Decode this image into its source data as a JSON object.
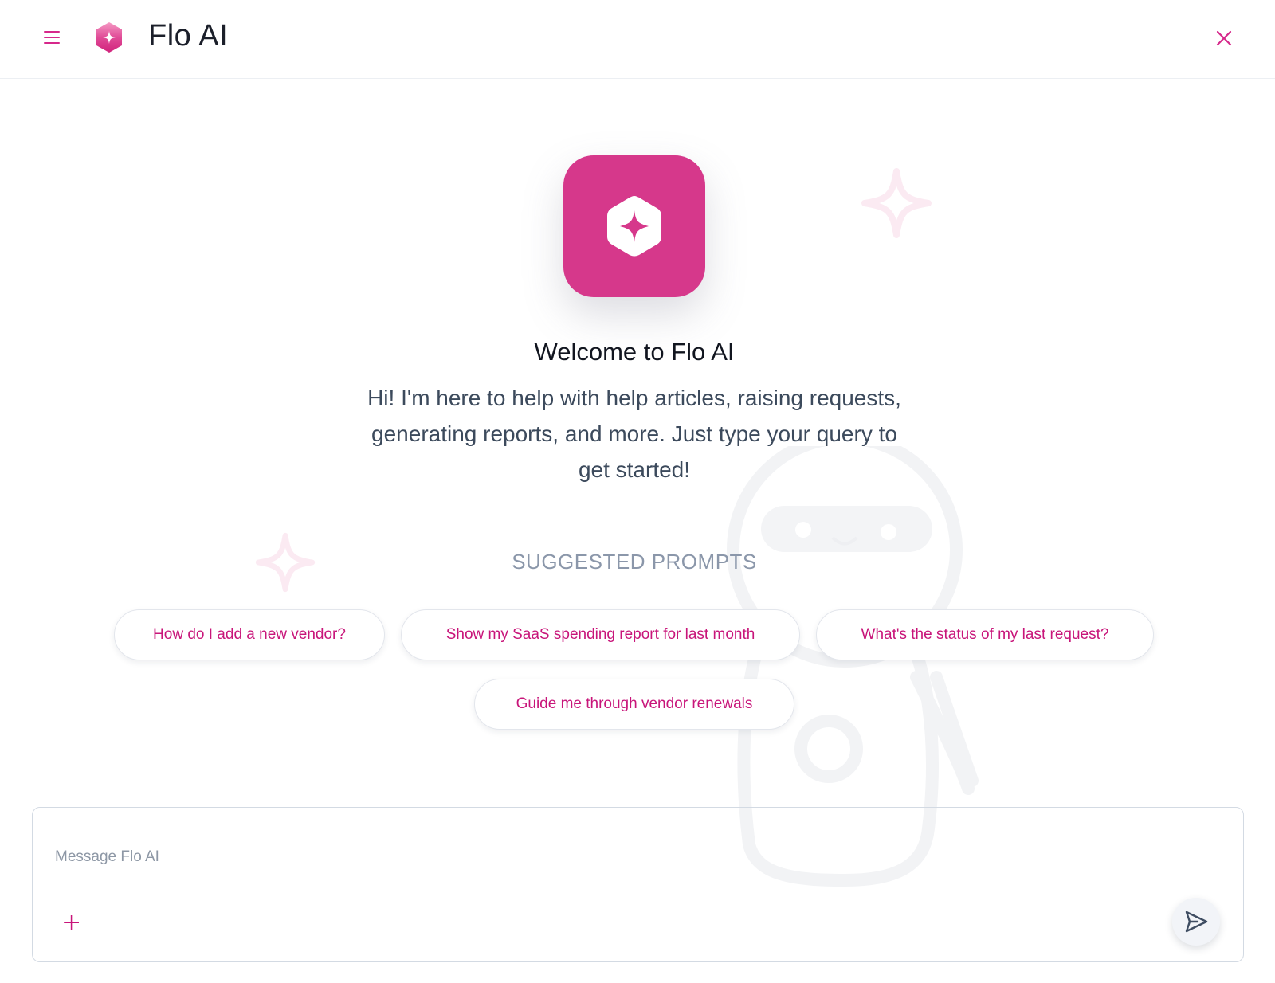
{
  "header": {
    "title": "Flo AI"
  },
  "hero": {
    "title": "Welcome to Flo AI",
    "description": "Hi! I'm here to help with help articles, raising requests, generating reports, and more. Just type your query to get started!"
  },
  "suggested": {
    "label": "SUGGESTED PROMPTS",
    "prompts": [
      "How do I add a new vendor?",
      "Show my SaaS spending report for last month",
      "What's the status of my last request?",
      "Guide me through vendor renewals"
    ]
  },
  "composer": {
    "placeholder": "Message Flo AI",
    "value": "",
    "attach_label": "+"
  },
  "colors": {
    "accent": "#d6388b",
    "prompt_text": "#c8157a",
    "title_text": "#11151f",
    "body_text": "#3c4a5c",
    "muted_text": "#8b97aa"
  },
  "icons": {
    "menu": "hamburger-menu-icon",
    "logo": "hexagon-sparkle-icon",
    "close": "close-icon",
    "attach": "plus-icon",
    "send": "send-icon"
  }
}
